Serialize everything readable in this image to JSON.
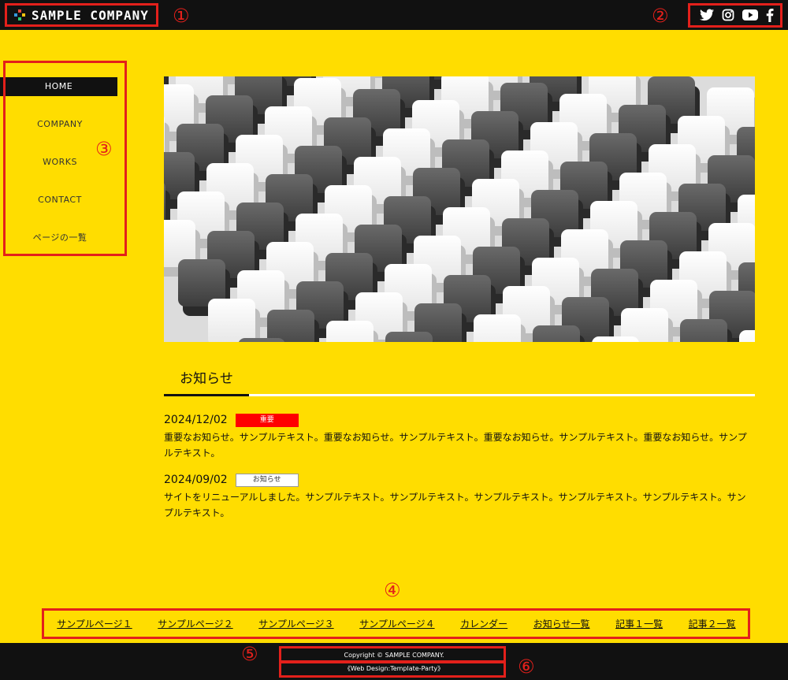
{
  "header": {
    "logo_text": "SAMPLE COMPANY",
    "social": [
      {
        "name": "twitter-icon"
      },
      {
        "name": "instagram-icon"
      },
      {
        "name": "youtube-icon"
      },
      {
        "name": "facebook-icon"
      }
    ]
  },
  "annotations": [
    "①",
    "②",
    "③",
    "④",
    "⑤",
    "⑥"
  ],
  "sidebar": {
    "items": [
      {
        "label": "HOME",
        "active": true
      },
      {
        "label": "COMPANY"
      },
      {
        "label": "WORKS"
      },
      {
        "label": "CONTACT"
      },
      {
        "label": "ページの一覧"
      }
    ]
  },
  "news": {
    "heading": "お知らせ",
    "items": [
      {
        "date": "2024/12/02",
        "badge": "重要",
        "text": "重要なお知らせ。サンプルテキスト。重要なお知らせ。サンプルテキスト。重要なお知らせ。サンプルテキスト。重要なお知らせ。サンプルテキスト。"
      },
      {
        "date": "2024/09/02",
        "badge": "お知らせ",
        "text": "サイトをリニューアルしました。サンプルテキスト。サンプルテキスト。サンプルテキスト。サンプルテキスト。サンプルテキスト。サンプルテキスト。"
      }
    ]
  },
  "footer_nav": [
    "サンプルページ１",
    "サンプルページ２",
    "サンプルページ３",
    "サンプルページ４",
    "カレンダー",
    "お知らせ一覧",
    "記事１一覧",
    "記事２一覧"
  ],
  "footer": {
    "copyright": "Copyright © SAMPLE COMPANY.",
    "design_credit": "《Web Design:Template-Party》"
  },
  "colors": {
    "background": "#ffdd00",
    "header": "#111111",
    "annotation": "#e3201b",
    "badge_important": "#ff0000"
  }
}
